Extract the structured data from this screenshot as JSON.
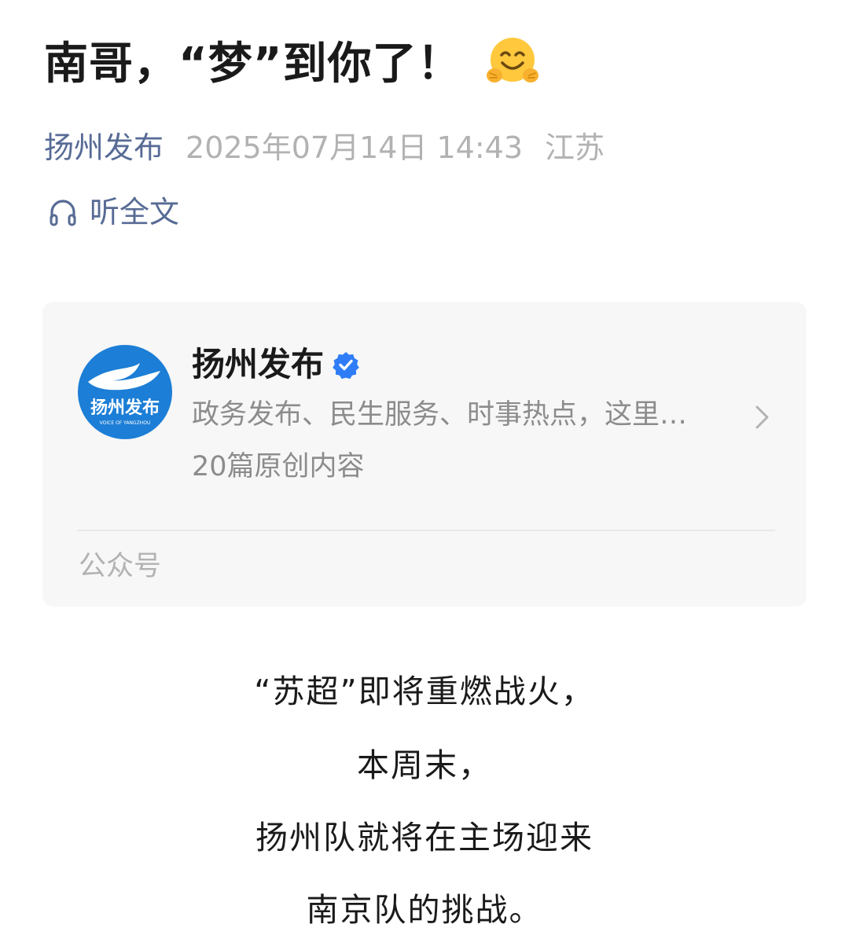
{
  "article": {
    "title": "南哥，“梦”到你了！",
    "title_emoji": "hugging-face-emoji",
    "author": "扬州发布",
    "date": "2025年07月14日 14:43",
    "location": "江苏",
    "listen_label": "听全文"
  },
  "account_card": {
    "name": "扬州发布",
    "logo_text": "扬州发布",
    "logo_subtext": "VOICE OF YANGZHOU",
    "description": "政务发布、民生服务、时事热点，这里…",
    "original_count": "20篇原创内容",
    "type_label": "公众号"
  },
  "body": [
    "“苏超”即将重燃战火，",
    "本周末，",
    "扬州队就将在主场迎来",
    "南京队的挑战。"
  ],
  "colors": {
    "link": "#576b95",
    "muted": "#b2b2b2",
    "verified": "#2f7df6",
    "logo": "#1c7ed6"
  }
}
